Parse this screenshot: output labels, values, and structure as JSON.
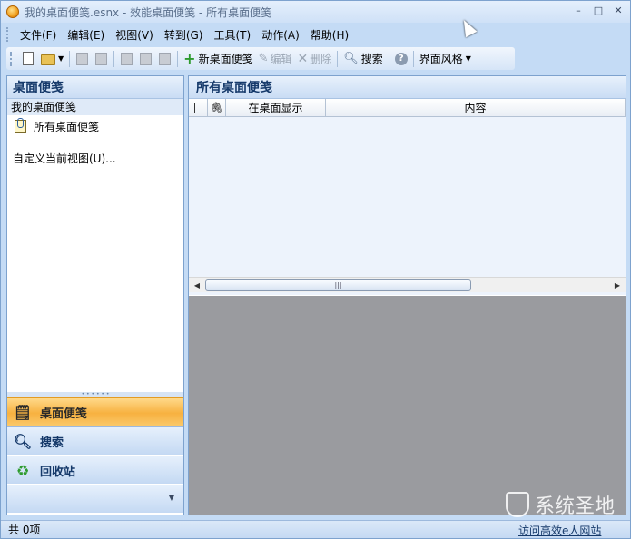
{
  "window": {
    "title": "我的桌面便笺.esnx - 效能桌面便笺 - 所有桌面便笺",
    "buttons": {
      "minimize": "–",
      "maximize": "□",
      "close": "✕"
    }
  },
  "menu": {
    "items": [
      {
        "label": "文件(F)"
      },
      {
        "label": "编辑(E)"
      },
      {
        "label": "视图(V)"
      },
      {
        "label": "转到(G)"
      },
      {
        "label": "工具(T)"
      },
      {
        "label": "动作(A)"
      },
      {
        "label": "帮助(H)"
      }
    ]
  },
  "toolbar": {
    "new_note": "新桌面便笺",
    "edit": "编辑",
    "delete": "删除",
    "search": "搜索",
    "theme": "界面风格"
  },
  "left": {
    "header": "桌面便笺",
    "group": "我的桌面便笺",
    "item": "所有桌面便笺",
    "custom_view": "自定义当前视图(U)...",
    "nav": [
      {
        "label": "桌面便笺",
        "icon": "note-icon",
        "active": true
      },
      {
        "label": "搜索",
        "icon": "search-icon",
        "active": false
      },
      {
        "label": "回收站",
        "icon": "recycle-bin-icon",
        "active": false
      }
    ]
  },
  "right": {
    "header": "所有桌面便笺",
    "columns": {
      "type_icon": "document-icon",
      "attach_icon": "paperclip-icon",
      "show_on_desktop": "在桌面显示",
      "content": "内容"
    }
  },
  "status": {
    "count": "共 0项",
    "link": "访问高效e人网站"
  },
  "watermark": "系统圣地",
  "colors": {
    "accent": "#15396a",
    "active_nav": "#f7b140",
    "preview_bg": "#9a9b9f"
  }
}
